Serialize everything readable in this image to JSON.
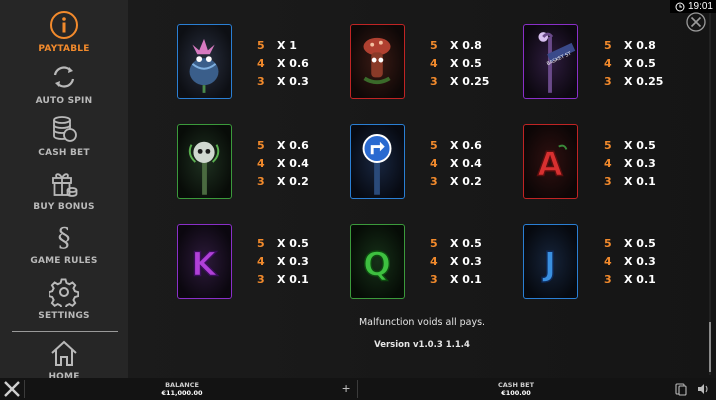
{
  "sidebar": {
    "items": [
      {
        "label": "PAYTABLE",
        "icon": "info-icon",
        "active": true
      },
      {
        "label": "AUTO SPIN",
        "icon": "refresh-icon",
        "active": false
      },
      {
        "label": "CASH BET",
        "icon": "coins-icon",
        "active": false
      },
      {
        "label": "BUY BONUS",
        "icon": "gift-icon",
        "active": false
      },
      {
        "label": "GAME RULES",
        "icon": "paragraph-icon",
        "active": false
      },
      {
        "label": "SETTINGS",
        "icon": "gear-icon",
        "active": false
      },
      {
        "label": "HOME",
        "icon": "home-icon",
        "active": false
      }
    ]
  },
  "status": {
    "time": "19:01"
  },
  "paytable": [
    {
      "symbol": "plant-monster",
      "border": "#2a7fd4",
      "pays": [
        {
          "n": "5",
          "x": "X 1"
        },
        {
          "n": "4",
          "x": "X 0.6"
        },
        {
          "n": "3",
          "x": "X 0.3"
        }
      ]
    },
    {
      "symbol": "mushroom-creature",
      "border": "#c02424",
      "pays": [
        {
          "n": "5",
          "x": "X 0.8"
        },
        {
          "n": "4",
          "x": "X 0.5"
        },
        {
          "n": "3",
          "x": "X 0.25"
        }
      ]
    },
    {
      "symbol": "street-sign",
      "border": "#8a2fc9",
      "pays": [
        {
          "n": "5",
          "x": "X 0.8"
        },
        {
          "n": "4",
          "x": "X 0.5"
        },
        {
          "n": "3",
          "x": "X 0.25"
        }
      ]
    },
    {
      "symbol": "skull-staff",
      "border": "#3b9a3b",
      "pays": [
        {
          "n": "5",
          "x": "X 0.6"
        },
        {
          "n": "4",
          "x": "X 0.4"
        },
        {
          "n": "3",
          "x": "X 0.2"
        }
      ]
    },
    {
      "symbol": "arrow-sign",
      "border": "#2a7fd4",
      "pays": [
        {
          "n": "5",
          "x": "X 0.6"
        },
        {
          "n": "4",
          "x": "X 0.4"
        },
        {
          "n": "3",
          "x": "X 0.2"
        }
      ]
    },
    {
      "symbol": "letter-a",
      "border": "#c02424",
      "pays": [
        {
          "n": "5",
          "x": "X 0.5"
        },
        {
          "n": "4",
          "x": "X 0.3"
        },
        {
          "n": "3",
          "x": "X 0.1"
        }
      ]
    },
    {
      "symbol": "letter-k",
      "border": "#8a2fc9",
      "pays": [
        {
          "n": "5",
          "x": "X 0.5"
        },
        {
          "n": "4",
          "x": "X 0.3"
        },
        {
          "n": "3",
          "x": "X 0.1"
        }
      ]
    },
    {
      "symbol": "letter-q",
      "border": "#3b9a3b",
      "pays": [
        {
          "n": "5",
          "x": "X 0.5"
        },
        {
          "n": "4",
          "x": "X 0.3"
        },
        {
          "n": "3",
          "x": "X 0.1"
        }
      ]
    },
    {
      "symbol": "letter-j",
      "border": "#2a7fd4",
      "pays": [
        {
          "n": "5",
          "x": "X 0.5"
        },
        {
          "n": "4",
          "x": "X 0.3"
        },
        {
          "n": "3",
          "x": "X 0.1"
        }
      ]
    }
  ],
  "symbol_letters": {
    "a": "A",
    "k": "K",
    "q": "Q",
    "j": "J",
    "sign": "BASKET ST"
  },
  "notes": {
    "malfunction": "Malfunction voids all pays.",
    "version": "Version v1.0.3 1.1.4"
  },
  "bottom_bar": {
    "balance_label": "BALANCE",
    "balance_value": "€11,000.00",
    "bet_label": "CASH BET",
    "bet_value": "€100.00",
    "plus": "+"
  },
  "colors": {
    "accent": "#f28a2c",
    "sidebar_bg": "#262626",
    "text_muted": "#b9b9b9"
  }
}
